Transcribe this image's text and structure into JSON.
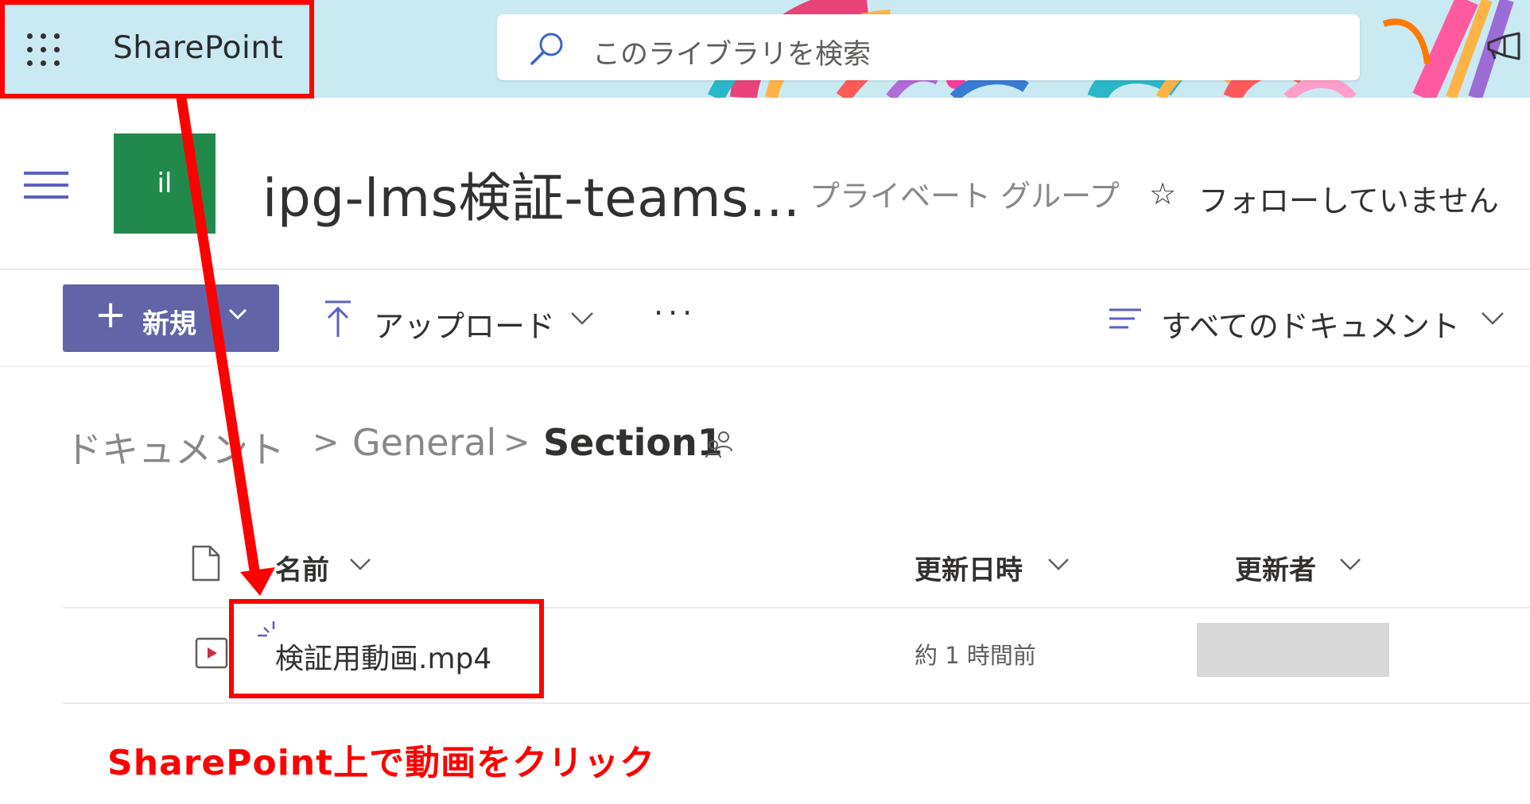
{
  "suite_bar": {
    "app_name": "SharePoint",
    "search_placeholder": "このライブラリを検索",
    "background_color": "#c9e9f3"
  },
  "site_header": {
    "logo_text": "il",
    "logo_color": "#21894b",
    "title": "ipg-lms検証-teams...",
    "site_type": "プライベート グループ",
    "follow_star": "☆",
    "follow_label": "フォローしていません"
  },
  "command_bar": {
    "new_label": "新規",
    "new_color": "#6264a7",
    "upload_label": "アップロード",
    "more_label": "···",
    "view_label": "すべてのドキュメント"
  },
  "breadcrumb": {
    "items": [
      "ドキュメント",
      "General",
      "Section1"
    ],
    "separator": ">"
  },
  "file_list": {
    "columns": {
      "name": "名前",
      "modified": "更新日時",
      "modified_by": "更新者"
    },
    "rows": [
      {
        "name": "検証用動画.mp4",
        "modified": "約 1 時間前",
        "modified_by": ""
      }
    ]
  },
  "annotation": {
    "caption": "SharePoint上で動画をクリック",
    "color": "#ff0000"
  }
}
